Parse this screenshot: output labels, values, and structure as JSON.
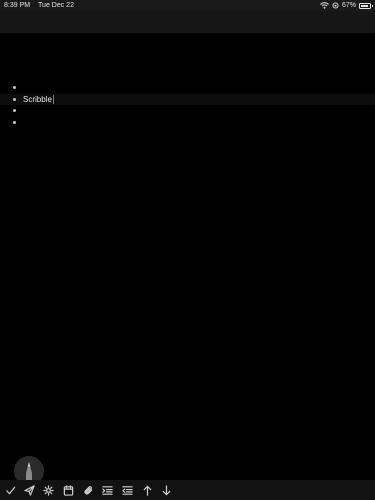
{
  "status_bar": {
    "time": "8:39 PM",
    "date": "Tue Dec 22",
    "battery_text": "67%",
    "battery_level": 0.67
  },
  "outline": {
    "rows": [
      {
        "text": ""
      },
      {
        "text": "Scribble",
        "editing": true
      },
      {
        "text": ""
      },
      {
        "text": ""
      }
    ]
  },
  "toolbar": {
    "icons": [
      "checkmark-icon",
      "send-icon",
      "gear-icon",
      "calendar-icon",
      "attachment-icon",
      "indent-icon",
      "outdent-icon",
      "arrow-up-icon",
      "arrow-down-icon"
    ]
  },
  "colors": {
    "background": "#000000",
    "cursor": "#4a78ff",
    "icon": "#cfcfcf"
  }
}
